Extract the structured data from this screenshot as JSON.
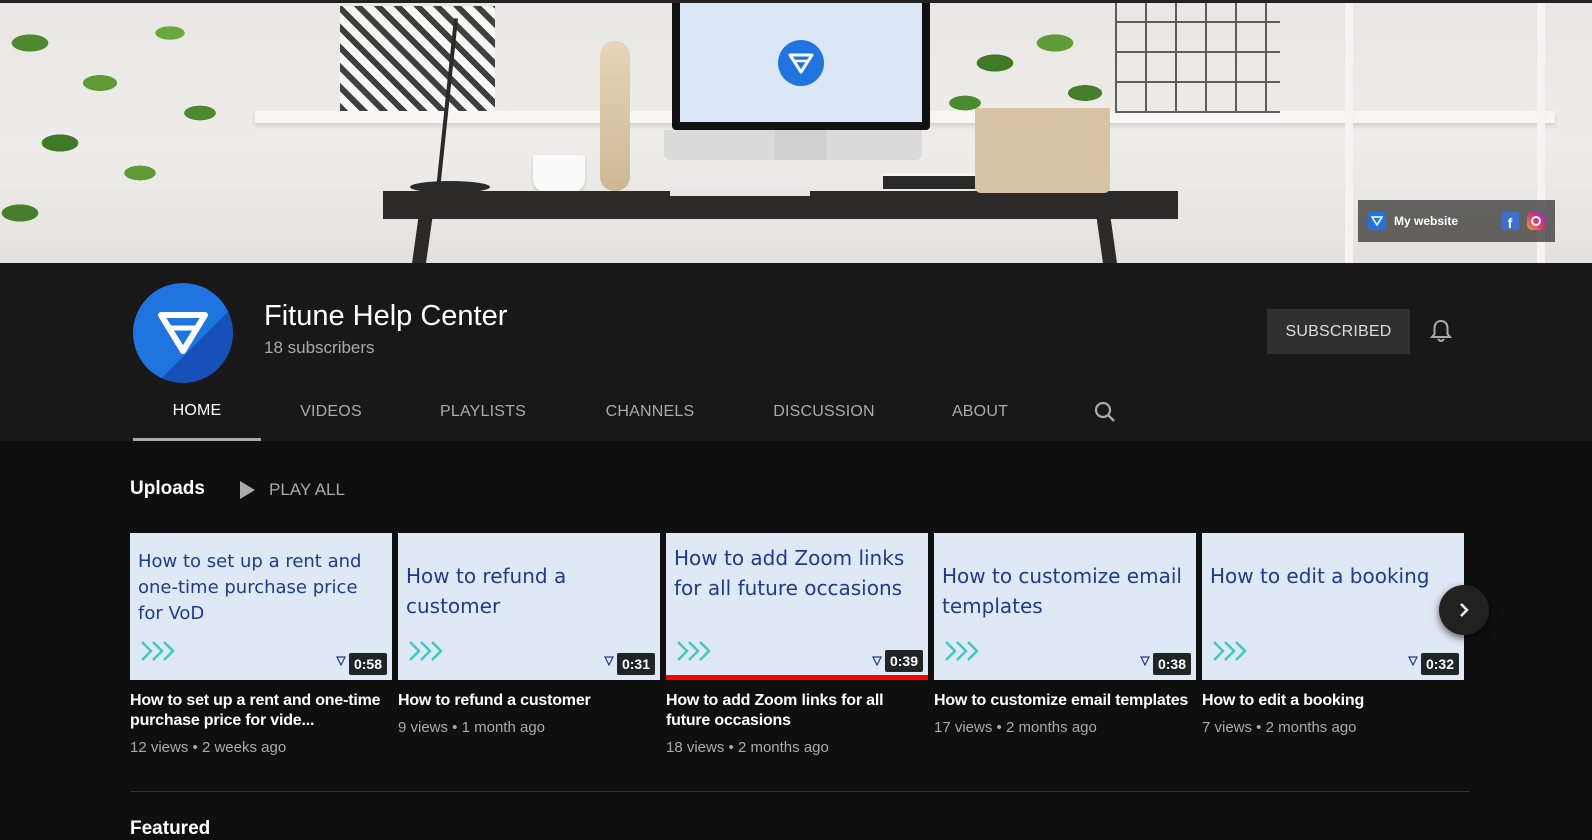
{
  "banner": {
    "links": {
      "website_label": "My website",
      "icons": [
        "website-favicon",
        "facebook-icon",
        "instagram-icon"
      ]
    }
  },
  "channel": {
    "name": "Fitune Help Center",
    "subscribers": "18 subscribers",
    "subscribe_label": "SUBSCRIBED",
    "brand_color": "#1f74e0"
  },
  "tabs": [
    {
      "label": "HOME",
      "active": true
    },
    {
      "label": "VIDEOS",
      "active": false
    },
    {
      "label": "PLAYLISTS",
      "active": false
    },
    {
      "label": "CHANNELS",
      "active": false
    },
    {
      "label": "DISCUSSION",
      "active": false
    },
    {
      "label": "ABOUT",
      "active": false
    }
  ],
  "uploads": {
    "title": "Uploads",
    "play_all": "PLAY ALL",
    "videos": [
      {
        "thumb_text": "How to set up a rent and one-time purchase price for VoD",
        "duration": "0:58",
        "title": "How to set up a rent and one-time purchase price for vide...",
        "meta": "12 views • 2 weeks ago",
        "watched_fraction": 0
      },
      {
        "thumb_text": "How to refund a customer",
        "duration": "0:31",
        "title": "How to refund a customer",
        "meta": "9 views • 1 month ago",
        "watched_fraction": 0
      },
      {
        "thumb_text": "How to add Zoom links for all future occasions",
        "duration": "0:39",
        "title": "How to add Zoom links for all future occasions",
        "meta": "18 views • 2 months ago",
        "watched_fraction": 1
      },
      {
        "thumb_text": "How to customize email templates",
        "duration": "0:38",
        "title": "How to customize email templates",
        "meta": "17 views • 2 months ago",
        "watched_fraction": 0
      },
      {
        "thumb_text": "How to edit a booking",
        "duration": "0:32",
        "title": "How to edit a booking",
        "meta": "7 views • 2 months ago",
        "watched_fraction": 0
      }
    ]
  },
  "next_section": {
    "title": "Featured"
  }
}
